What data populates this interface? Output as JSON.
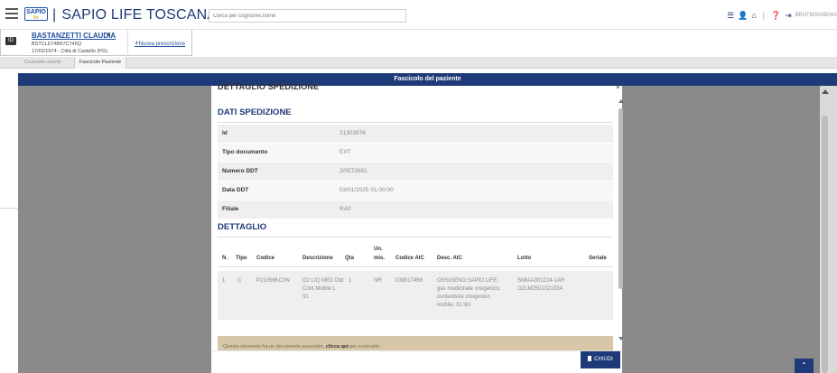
{
  "header": {
    "logo_text": "SAPIO",
    "logo_sub": "life",
    "app_title": "SAPIO LIFE TOSCANA",
    "search_placeholder": "Cerca per cognome,nome",
    "user_code": "BBNTMS04B04A"
  },
  "patient": {
    "name": "BASTANZETTI CLAUDIA",
    "fiscal_code": "BSTCLD74B57C745Q",
    "birth": "17/02/1974 - Città di Castello (PG)",
    "close": "×",
    "new_prescription": "Nuova prescrizione",
    "new_prescription_plus": "+"
  },
  "tabs": [
    {
      "label": "Cruscotto servizi"
    },
    {
      "label": "Fascicolo Paziente"
    }
  ],
  "band_title": "Fascicolo del paziente",
  "modal": {
    "title": "DETTAGLIO SPEDIZIONE",
    "close": "×",
    "section_data": "DATI SPEDIZIONE",
    "rows": [
      {
        "label": "Id",
        "value": "21303576"
      },
      {
        "label": "Tipo documento",
        "value": "EXT"
      },
      {
        "label": "Numero DDT",
        "value": "2/0572691"
      },
      {
        "label": "Data DDT",
        "value": "03/01/2025 01:00:00"
      },
      {
        "label": "Filiale",
        "value": "RA0"
      }
    ],
    "section_detail": "DETTAGLIO",
    "columns": {
      "n": "N.",
      "tipo": "Tipo",
      "codice": "Codice",
      "descrizione": "Descrizione",
      "qta": "Qta",
      "unmis_1": "Un.",
      "unmis_2": "mis.",
      "codice_aic": "Codice AIC",
      "desc_aic": "Desc. AIC",
      "lotto": "Lotto",
      "seriale": "Seriale"
    },
    "items": [
      {
        "n": "1",
        "tipo": "C",
        "codice": "P21056KC0N",
        "descrizione_lines": [
          "O2 LIQ MED Dtd",
          "Cont.Mobile L",
          "31"
        ],
        "qta": "1",
        "unmis": "NR",
        "codice_aic": "039017468",
        "desc_aic_lines": [
          "OSSIGENO SAPIO LIFE,",
          "gas medicinale criogenico,",
          "contenitore criogenico",
          "mobile, 31 litri"
        ],
        "lotto_lines": [
          "SMIAA301224-1AR",
          "O2LM250102103A"
        ],
        "seriale": ""
      }
    ],
    "info_prefix": "Questo elemento ha un documento associato,",
    "info_link": "clicca qui",
    "info_suffix": "per scaricarlo.",
    "close_button": "CHIUDI"
  },
  "colors": {
    "brand_blue": "#1e3a78",
    "overlay_gray": "#8a8a8a",
    "info_bg": "#d7c6a8"
  },
  "icons": {
    "menu": "hamburger-menu-icon",
    "list": "list-icon",
    "user": "user-icon",
    "home": "home-icon",
    "help": "help-icon",
    "logout": "logout-icon"
  }
}
